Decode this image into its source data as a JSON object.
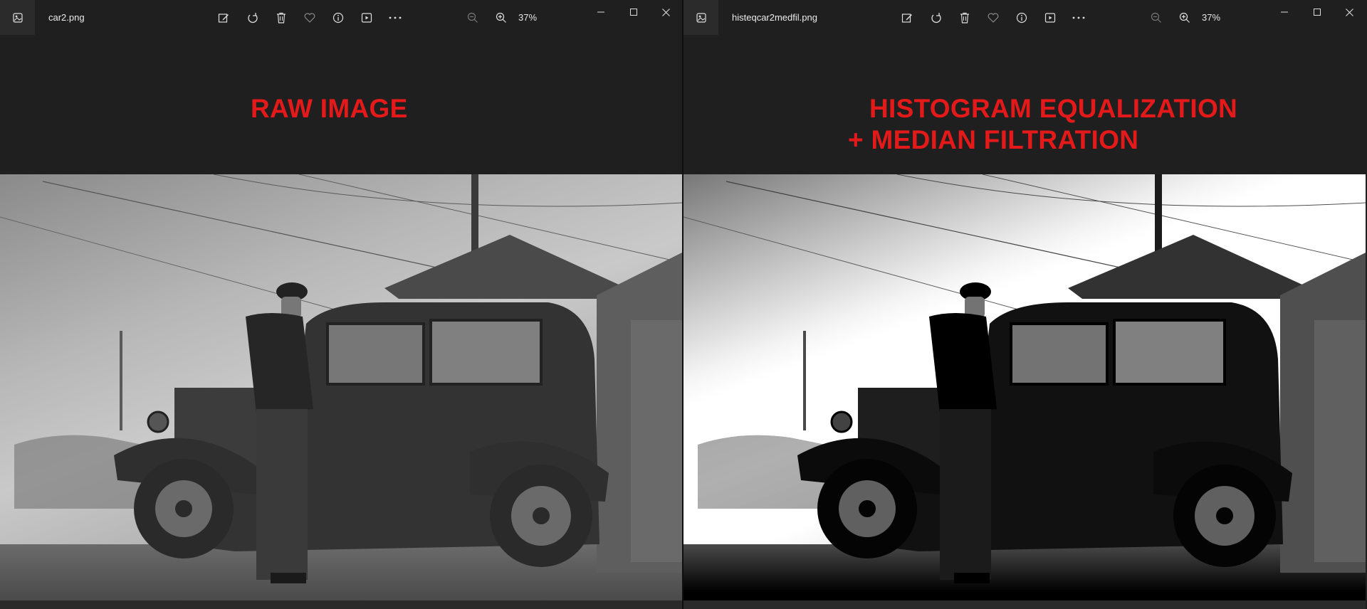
{
  "windows": [
    {
      "file_name": "car2.png",
      "zoom": "37%",
      "caption_lines": [
        "RAW IMAGE"
      ],
      "image_variant": "raw"
    },
    {
      "file_name": "histeqcar2medfil.png",
      "zoom": "37%",
      "caption_lines": [
        "HISTOGRAM EQUALIZATION",
        "+ MEDIAN FILTRATION"
      ],
      "image_variant": "equalized"
    }
  ],
  "toolbar_icons": [
    "edit-image-icon",
    "rotate-icon",
    "delete-icon",
    "favorite-icon",
    "info-icon",
    "slideshow-icon",
    "more-options-icon",
    "zoom-out-icon",
    "zoom-in-icon"
  ],
  "window_controls": [
    "minimize-icon",
    "maximize-icon",
    "close-icon"
  ],
  "colors": {
    "caption": "#e41a1a",
    "background": "#1f1f1f"
  }
}
